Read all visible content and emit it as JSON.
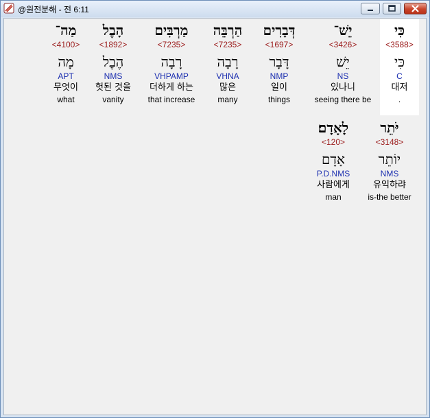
{
  "window": {
    "title": "@원전분해 - 전 6:11"
  },
  "words": [
    {
      "heb": "כִּי",
      "strong": "<3588>",
      "lemma": "כִּי",
      "morph": "C",
      "kor": "대저",
      "eng": "."
    },
    {
      "heb": "יֵשׁ־",
      "strong": "<3426>",
      "lemma": "יֵשׁ",
      "morph": "NS",
      "kor": "있나니",
      "eng": "seeing there be"
    },
    {
      "heb": "דְּבָרִים",
      "strong": "<1697>",
      "lemma": "דָּבָר",
      "morph": "NMP",
      "kor": "일이",
      "eng": "things"
    },
    {
      "heb": "הַרְבֵּה",
      "strong": "<7235>",
      "lemma": "רָבָה",
      "morph": "VHNA",
      "kor": "많은",
      "eng": "many"
    },
    {
      "heb": "מַרְבִּים",
      "strong": "<7235>",
      "lemma": "רָבָה",
      "morph": "VHPAMP",
      "kor": "더하게 하는",
      "eng": "that increase"
    },
    {
      "heb": "הָבֶל",
      "strong": "<1892>",
      "lemma": "הֶבֶל",
      "morph": "NMS",
      "kor": "헛된 것을",
      "eng": "vanity"
    },
    {
      "heb": "מַה־",
      "strong": "<4100>",
      "lemma": "מָה",
      "morph": "APT",
      "kor": "무엇이",
      "eng": "what"
    },
    {
      "heb": "יֹּתֵר",
      "strong": "<3148>",
      "lemma": "יוֹתֵר",
      "morph": "NMS",
      "kor": "유익하랴",
      "eng": "is-the better"
    },
    {
      "heb": "לָאָדָם׃",
      "strong": "<120>",
      "lemma": "אָדָם",
      "morph": "P.D.NMS",
      "kor": "사람에게",
      "eng": "man"
    }
  ]
}
